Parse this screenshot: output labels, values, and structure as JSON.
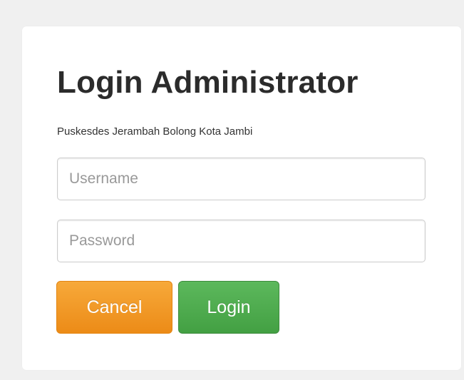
{
  "login": {
    "title": "Login Administrator",
    "subtitle": "Puskesdes Jerambah Bolong Kota Jambi",
    "username": {
      "value": "",
      "placeholder": "Username"
    },
    "password": {
      "value": "",
      "placeholder": "Password"
    },
    "cancel_label": "Cancel",
    "login_label": "Login"
  },
  "colors": {
    "background": "#f0f0f0",
    "card": "#ffffff",
    "cancel_button": "#f0961f",
    "login_button": "#4cae4c",
    "title_text": "#2b2b2b"
  }
}
